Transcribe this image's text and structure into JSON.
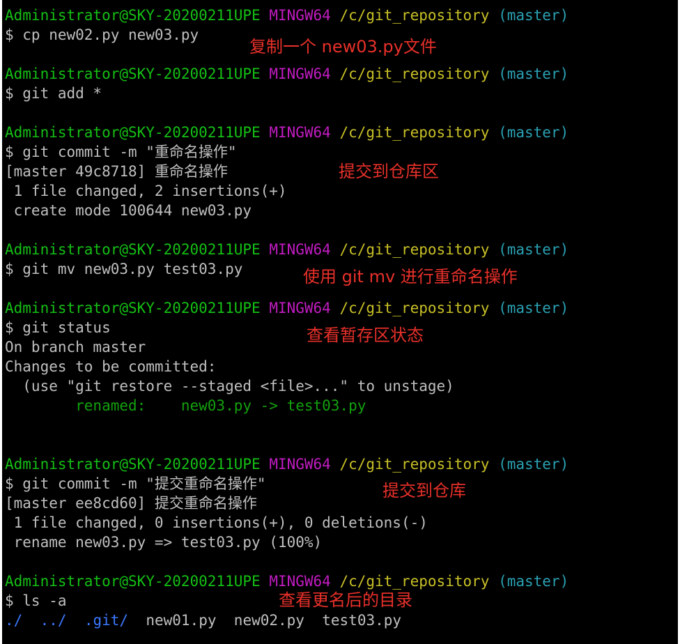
{
  "prompt": {
    "user": "Administrator@SKY-20200211UPE",
    "env": "MINGW64",
    "path": "/c/git_repository",
    "branch": "(master)"
  },
  "lines": {
    "cmd1": "$ cp new02.py new03.py",
    "cmd2": "$ git add *",
    "cmd3": "$ git commit -m \"重命名操作\"",
    "out3_1": "[master 49c8718] 重命名操作",
    "out3_2": " 1 file changed, 2 insertions(+)",
    "out3_3": " create mode 100644 new03.py",
    "cmd4": "$ git mv new03.py test03.py",
    "cmd5": "$ git status",
    "out5_1": "On branch master",
    "out5_2": "Changes to be committed:",
    "out5_3": "  (use \"git restore --staged <file>...\" to unstage)",
    "out5_4": "        renamed:    new03.py -> test03.py",
    "cmd6": "$ git commit -m \"提交重命名操作\"",
    "out6_1": "[master ee8cd60] 提交重命名操作",
    "out6_2": " 1 file changed, 0 insertions(+), 0 deletions(-)",
    "out6_3": " rename new03.py => test03.py (100%)",
    "cmd7": "$ ls -a",
    "ls": {
      "e1": "./",
      "e2": "../",
      "e3": ".git/",
      "e4": "new01.py",
      "e5": "new02.py",
      "e6": "test03.py"
    }
  },
  "annotations": {
    "a1": "复制一个 new03.py文件",
    "a2": "提交到仓库区",
    "a3": "使用 git mv 进行重命名操作",
    "a4": "查看暂存区状态",
    "a5": "提交到仓库",
    "a6": "查看更名后的目录"
  },
  "colors": {
    "background": "#000000",
    "text": "#c0c0c0",
    "user": "#15c015",
    "env": "#c01cc0",
    "path": "#c8c026",
    "branch": "#2aa1b3",
    "directory": "#3b78ff",
    "annotation": "#e8302a"
  }
}
